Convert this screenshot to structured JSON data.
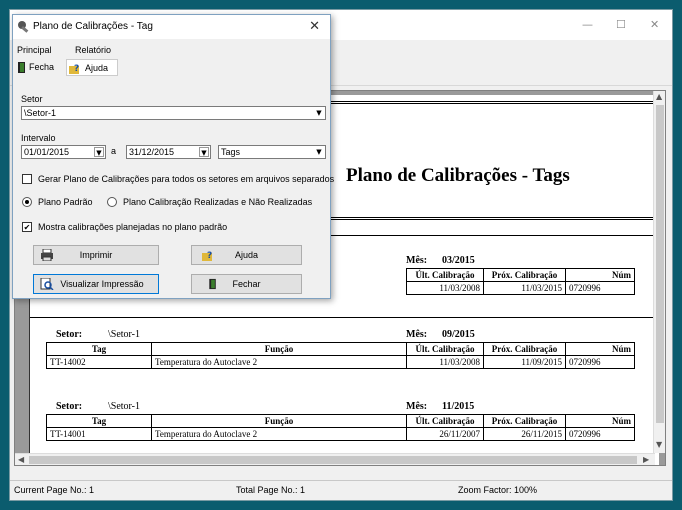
{
  "outer_window": {
    "controls": {
      "minimize": "—",
      "maximize": "☐",
      "close": "✕"
    }
  },
  "report": {
    "title": "Plano de Calibrações - Tags",
    "blocks": [
      {
        "mes_label": "Mês:",
        "mes_value": "03/2015",
        "columns": [
          "Últ. Calibração",
          "Próx. Calibração",
          "Núm"
        ],
        "rows": [
          {
            "ult": "11/03/2008",
            "prox": "11/03/2015",
            "num": "0720996"
          }
        ]
      },
      {
        "setor_label": "Setor:",
        "setor_value": "\\Setor-1",
        "mes_label": "Mês:",
        "mes_value": "09/2015",
        "columns": [
          "Tag",
          "Função",
          "Últ. Calibração",
          "Próx. Calibração",
          "Núm"
        ],
        "rows": [
          {
            "tag": "TT-14002",
            "funcao": "Temperatura do Autoclave 2",
            "ult": "11/03/2008",
            "prox": "11/09/2015",
            "num": "0720996"
          }
        ]
      },
      {
        "setor_label": "Setor:",
        "setor_value": "\\Setor-1",
        "mes_label": "Mês:",
        "mes_value": "11/2015",
        "columns": [
          "Tag",
          "Função",
          "Últ. Calibração",
          "Próx. Calibração",
          "Núm"
        ],
        "rows": [
          {
            "tag": "TT-14001",
            "funcao": "Temperatura do Autoclave 2",
            "ult": "26/11/2007",
            "prox": "26/11/2015",
            "num": "0720996"
          }
        ]
      }
    ]
  },
  "statusbar": {
    "current_page": "Current Page No.: 1",
    "total_page": "Total Page No.: 1",
    "zoom": "Zoom Factor: 100%"
  },
  "dialog": {
    "title": "Plano de Calibrações - Tag",
    "close": "✕",
    "menu": [
      "Principal",
      "Relatório"
    ],
    "toolbar": {
      "fecha": "Fecha",
      "ajuda": "Ajuda"
    },
    "setor_label": "Setor",
    "setor_value": "\\Setor-1",
    "intervalo_label": "Intervalo",
    "date_from": "01/01/2015",
    "date_sep": "a",
    "date_to": "31/12/2015",
    "type_value": "Tags",
    "chk_separados": "Gerar Plano de Calibrações para todos os setores em arquivos separados",
    "radio_padrao": "Plano Padrão",
    "radio_realizadas": "Plano Calibração Realizadas e Não Realizadas",
    "chk_mostra": "Mostra calibrações planejadas no plano padrão",
    "btn_imprimir": "Imprimir",
    "btn_ajuda": "Ajuda",
    "btn_visualizar": "Visualizar Impressão",
    "btn_fechar": "Fechar"
  },
  "colors": {
    "background": "#0b5c6e",
    "focus_border": "#0078d7"
  }
}
